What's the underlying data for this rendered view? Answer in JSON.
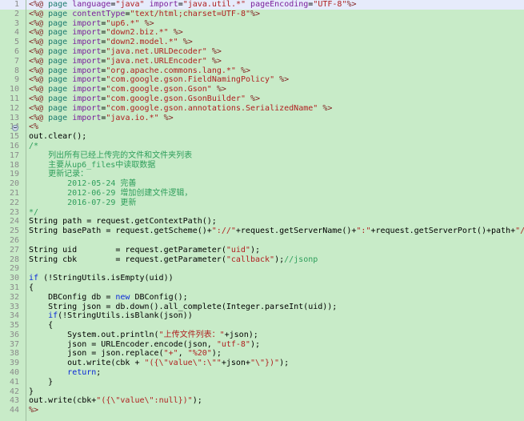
{
  "app": {
    "name": "code-editor",
    "language": "JSP",
    "total_lines": 44,
    "current_line": 1
  },
  "colors": {
    "background": "#c8ebc8",
    "current_line_highlight": "#e6ebfb",
    "gutter_text": "#8a8a8a",
    "gutter_rule": "#9fbf9f",
    "directive": "#7f1f1f",
    "tag": "#1a7a6e",
    "attribute": "#7a1f9c",
    "string": "#b02020",
    "comment": "#2e9e5b",
    "keyword": "#0a28d8",
    "plain": "#000000"
  },
  "lines": [
    {
      "n": 1,
      "current": true,
      "tokens": [
        {
          "t": "dir",
          "s": "<%@"
        },
        {
          "t": "plain",
          "s": " "
        },
        {
          "t": "tag",
          "s": "page"
        },
        {
          "t": "plain",
          "s": " "
        },
        {
          "t": "attr",
          "s": "language"
        },
        {
          "t": "op",
          "s": "="
        },
        {
          "t": "str",
          "s": "\"java\""
        },
        {
          "t": "plain",
          "s": " "
        },
        {
          "t": "attr",
          "s": "import"
        },
        {
          "t": "op",
          "s": "="
        },
        {
          "t": "str",
          "s": "\"java.util.*\""
        },
        {
          "t": "plain",
          "s": " "
        },
        {
          "t": "attr",
          "s": "pageEncoding"
        },
        {
          "t": "op",
          "s": "="
        },
        {
          "t": "str",
          "s": "\"UTF-8\""
        },
        {
          "t": "dir",
          "s": "%>"
        }
      ]
    },
    {
      "n": 2,
      "tokens": [
        {
          "t": "dir",
          "s": "<%@"
        },
        {
          "t": "plain",
          "s": " "
        },
        {
          "t": "tag",
          "s": "page"
        },
        {
          "t": "plain",
          "s": " "
        },
        {
          "t": "attr",
          "s": "contentType"
        },
        {
          "t": "op",
          "s": "="
        },
        {
          "t": "str",
          "s": "\"text/html;charset=UTF-8\""
        },
        {
          "t": "dir",
          "s": "%>"
        }
      ]
    },
    {
      "n": 3,
      "tokens": [
        {
          "t": "dir",
          "s": "<%@"
        },
        {
          "t": "plain",
          "s": " "
        },
        {
          "t": "tag",
          "s": "page"
        },
        {
          "t": "plain",
          "s": " "
        },
        {
          "t": "attr",
          "s": "import"
        },
        {
          "t": "op",
          "s": "="
        },
        {
          "t": "str",
          "s": "\"up6.*\""
        },
        {
          "t": "plain",
          "s": " "
        },
        {
          "t": "dir",
          "s": "%>"
        }
      ]
    },
    {
      "n": 4,
      "tokens": [
        {
          "t": "dir",
          "s": "<%@"
        },
        {
          "t": "plain",
          "s": " "
        },
        {
          "t": "tag",
          "s": "page"
        },
        {
          "t": "plain",
          "s": " "
        },
        {
          "t": "attr",
          "s": "import"
        },
        {
          "t": "op",
          "s": "="
        },
        {
          "t": "str",
          "s": "\"down2.biz.*\""
        },
        {
          "t": "plain",
          "s": " "
        },
        {
          "t": "dir",
          "s": "%>"
        }
      ]
    },
    {
      "n": 5,
      "tokens": [
        {
          "t": "dir",
          "s": "<%@"
        },
        {
          "t": "plain",
          "s": " "
        },
        {
          "t": "tag",
          "s": "page"
        },
        {
          "t": "plain",
          "s": " "
        },
        {
          "t": "attr",
          "s": "import"
        },
        {
          "t": "op",
          "s": "="
        },
        {
          "t": "str",
          "s": "\"down2.model.*\""
        },
        {
          "t": "plain",
          "s": " "
        },
        {
          "t": "dir",
          "s": "%>"
        }
      ]
    },
    {
      "n": 6,
      "tokens": [
        {
          "t": "dir",
          "s": "<%@"
        },
        {
          "t": "plain",
          "s": " "
        },
        {
          "t": "tag",
          "s": "page"
        },
        {
          "t": "plain",
          "s": " "
        },
        {
          "t": "attr",
          "s": "import"
        },
        {
          "t": "op",
          "s": "="
        },
        {
          "t": "str",
          "s": "\"java.net.URLDecoder\""
        },
        {
          "t": "plain",
          "s": " "
        },
        {
          "t": "dir",
          "s": "%>"
        }
      ]
    },
    {
      "n": 7,
      "tokens": [
        {
          "t": "dir",
          "s": "<%@"
        },
        {
          "t": "plain",
          "s": " "
        },
        {
          "t": "tag",
          "s": "page"
        },
        {
          "t": "plain",
          "s": " "
        },
        {
          "t": "attr",
          "s": "import"
        },
        {
          "t": "op",
          "s": "="
        },
        {
          "t": "str",
          "s": "\"java.net.URLEncoder\""
        },
        {
          "t": "plain",
          "s": " "
        },
        {
          "t": "dir",
          "s": "%>"
        }
      ]
    },
    {
      "n": 8,
      "tokens": [
        {
          "t": "dir",
          "s": "<%@"
        },
        {
          "t": "plain",
          "s": " "
        },
        {
          "t": "tag",
          "s": "page"
        },
        {
          "t": "plain",
          "s": " "
        },
        {
          "t": "attr",
          "s": "import"
        },
        {
          "t": "op",
          "s": "="
        },
        {
          "t": "str",
          "s": "\"org.apache.commons.lang.*\""
        },
        {
          "t": "plain",
          "s": " "
        },
        {
          "t": "dir",
          "s": "%>"
        }
      ]
    },
    {
      "n": 9,
      "tokens": [
        {
          "t": "dir",
          "s": "<%@"
        },
        {
          "t": "plain",
          "s": " "
        },
        {
          "t": "tag",
          "s": "page"
        },
        {
          "t": "plain",
          "s": " "
        },
        {
          "t": "attr",
          "s": "import"
        },
        {
          "t": "op",
          "s": "="
        },
        {
          "t": "str",
          "s": "\"com.google.gson.FieldNamingPolicy\""
        },
        {
          "t": "plain",
          "s": " "
        },
        {
          "t": "dir",
          "s": "%>"
        }
      ]
    },
    {
      "n": 10,
      "tokens": [
        {
          "t": "dir",
          "s": "<%@"
        },
        {
          "t": "plain",
          "s": " "
        },
        {
          "t": "tag",
          "s": "page"
        },
        {
          "t": "plain",
          "s": " "
        },
        {
          "t": "attr",
          "s": "import"
        },
        {
          "t": "op",
          "s": "="
        },
        {
          "t": "str",
          "s": "\"com.google.gson.Gson\""
        },
        {
          "t": "plain",
          "s": " "
        },
        {
          "t": "dir",
          "s": "%>"
        }
      ]
    },
    {
      "n": 11,
      "tokens": [
        {
          "t": "dir",
          "s": "<%@"
        },
        {
          "t": "plain",
          "s": " "
        },
        {
          "t": "tag",
          "s": "page"
        },
        {
          "t": "plain",
          "s": " "
        },
        {
          "t": "attr",
          "s": "import"
        },
        {
          "t": "op",
          "s": "="
        },
        {
          "t": "str",
          "s": "\"com.google.gson.GsonBuilder\""
        },
        {
          "t": "plain",
          "s": " "
        },
        {
          "t": "dir",
          "s": "%>"
        }
      ]
    },
    {
      "n": 12,
      "tokens": [
        {
          "t": "dir",
          "s": "<%@"
        },
        {
          "t": "plain",
          "s": " "
        },
        {
          "t": "tag",
          "s": "page"
        },
        {
          "t": "plain",
          "s": " "
        },
        {
          "t": "attr",
          "s": "import"
        },
        {
          "t": "op",
          "s": "="
        },
        {
          "t": "str",
          "s": "\"com.google.gson.annotations.SerializedName\""
        },
        {
          "t": "plain",
          "s": " "
        },
        {
          "t": "dir",
          "s": "%>"
        }
      ]
    },
    {
      "n": 13,
      "tokens": [
        {
          "t": "dir",
          "s": "<%@"
        },
        {
          "t": "plain",
          "s": " "
        },
        {
          "t": "tag",
          "s": "page"
        },
        {
          "t": "plain",
          "s": " "
        },
        {
          "t": "attr",
          "s": "import"
        },
        {
          "t": "op",
          "s": "="
        },
        {
          "t": "str",
          "s": "\"java.io.*\""
        },
        {
          "t": "plain",
          "s": " "
        },
        {
          "t": "dir",
          "s": "%>"
        }
      ]
    },
    {
      "n": 14,
      "fold": true,
      "tokens": [
        {
          "t": "dir",
          "s": "<%"
        }
      ]
    },
    {
      "n": 15,
      "tokens": [
        {
          "t": "plain",
          "s": "out.clear();"
        }
      ]
    },
    {
      "n": 16,
      "tokens": [
        {
          "t": "cmt",
          "s": "/*"
        }
      ]
    },
    {
      "n": 17,
      "tokens": [
        {
          "t": "cmt",
          "s": "    列出所有已经上传完的文件和文件夹列表"
        }
      ]
    },
    {
      "n": 18,
      "tokens": [
        {
          "t": "cmt",
          "s": "    主要从up6_files中读取数据"
        }
      ]
    },
    {
      "n": 19,
      "tokens": [
        {
          "t": "cmt",
          "s": "    更新记录："
        }
      ]
    },
    {
      "n": 20,
      "tokens": [
        {
          "t": "cmt",
          "s": "        2012-05-24 完善"
        }
      ]
    },
    {
      "n": 21,
      "tokens": [
        {
          "t": "cmt",
          "s": "        2012-06-29 增加创建文件逻辑，"
        }
      ]
    },
    {
      "n": 22,
      "tokens": [
        {
          "t": "cmt",
          "s": "        2016-07-29 更新"
        }
      ]
    },
    {
      "n": 23,
      "tokens": [
        {
          "t": "cmt",
          "s": "*/"
        }
      ]
    },
    {
      "n": 24,
      "tokens": [
        {
          "t": "plain",
          "s": "String path = request.getContextPath();"
        }
      ]
    },
    {
      "n": 25,
      "tokens": [
        {
          "t": "plain",
          "s": "String basePath = request.getScheme()+"
        },
        {
          "t": "str",
          "s": "\"://\""
        },
        {
          "t": "plain",
          "s": "+request.getServerName()+"
        },
        {
          "t": "str",
          "s": "\":\""
        },
        {
          "t": "plain",
          "s": "+request.getServerPort()+path+"
        },
        {
          "t": "str",
          "s": "\"/\""
        },
        {
          "t": "plain",
          "s": ";"
        }
      ]
    },
    {
      "n": 26,
      "tokens": []
    },
    {
      "n": 27,
      "tokens": [
        {
          "t": "plain",
          "s": "String uid        = request.getParameter("
        },
        {
          "t": "str",
          "s": "\"uid\""
        },
        {
          "t": "plain",
          "s": ");"
        }
      ]
    },
    {
      "n": 28,
      "tokens": [
        {
          "t": "plain",
          "s": "String cbk        = request.getParameter("
        },
        {
          "t": "str",
          "s": "\"callback\""
        },
        {
          "t": "plain",
          "s": ");"
        },
        {
          "t": "cmt",
          "s": "//jsonp"
        }
      ]
    },
    {
      "n": 29,
      "tokens": []
    },
    {
      "n": 30,
      "tokens": [
        {
          "t": "kw",
          "s": "if"
        },
        {
          "t": "plain",
          "s": " (!StringUtils.isEmpty(uid))"
        }
      ]
    },
    {
      "n": 31,
      "tokens": [
        {
          "t": "plain",
          "s": "{"
        }
      ]
    },
    {
      "n": 32,
      "tokens": [
        {
          "t": "plain",
          "s": "    DBConfig db = "
        },
        {
          "t": "kw",
          "s": "new"
        },
        {
          "t": "plain",
          "s": " DBConfig();"
        }
      ]
    },
    {
      "n": 33,
      "tokens": [
        {
          "t": "plain",
          "s": "    String json = db.down().all_complete(Integer.parseInt(uid));"
        }
      ]
    },
    {
      "n": 34,
      "tokens": [
        {
          "t": "plain",
          "s": "    "
        },
        {
          "t": "kw",
          "s": "if"
        },
        {
          "t": "plain",
          "s": "(!StringUtils.isBlank(json))"
        }
      ]
    },
    {
      "n": 35,
      "tokens": [
        {
          "t": "plain",
          "s": "    {"
        }
      ]
    },
    {
      "n": 36,
      "tokens": [
        {
          "t": "plain",
          "s": "        System.out.println("
        },
        {
          "t": "str",
          "s": "\"上传文件列表：\""
        },
        {
          "t": "plain",
          "s": "+json);"
        }
      ]
    },
    {
      "n": 37,
      "tokens": [
        {
          "t": "plain",
          "s": "        json = URLEncoder.encode(json, "
        },
        {
          "t": "str",
          "s": "\"utf-8\""
        },
        {
          "t": "plain",
          "s": ");"
        }
      ]
    },
    {
      "n": 38,
      "tokens": [
        {
          "t": "plain",
          "s": "        json = json.replace("
        },
        {
          "t": "str",
          "s": "\"+\""
        },
        {
          "t": "plain",
          "s": ", "
        },
        {
          "t": "str",
          "s": "\"%20\""
        },
        {
          "t": "plain",
          "s": ");"
        }
      ]
    },
    {
      "n": 39,
      "tokens": [
        {
          "t": "plain",
          "s": "        out.write(cbk + "
        },
        {
          "t": "str",
          "s": "\"({\\\"value\\\":\\\"\""
        },
        {
          "t": "plain",
          "s": "+json+"
        },
        {
          "t": "str",
          "s": "\"\\\"})\""
        },
        {
          "t": "plain",
          "s": ");"
        }
      ]
    },
    {
      "n": 40,
      "tokens": [
        {
          "t": "plain",
          "s": "        "
        },
        {
          "t": "kw",
          "s": "return"
        },
        {
          "t": "plain",
          "s": ";"
        }
      ]
    },
    {
      "n": 41,
      "tokens": [
        {
          "t": "plain",
          "s": "    }"
        }
      ]
    },
    {
      "n": 42,
      "tokens": [
        {
          "t": "plain",
          "s": "}"
        }
      ]
    },
    {
      "n": 43,
      "tokens": [
        {
          "t": "plain",
          "s": "out.write(cbk+"
        },
        {
          "t": "str",
          "s": "\"({\\\"value\\\":null})\""
        },
        {
          "t": "plain",
          "s": ");"
        }
      ]
    },
    {
      "n": 44,
      "tokens": [
        {
          "t": "dir",
          "s": "%>"
        }
      ]
    }
  ]
}
